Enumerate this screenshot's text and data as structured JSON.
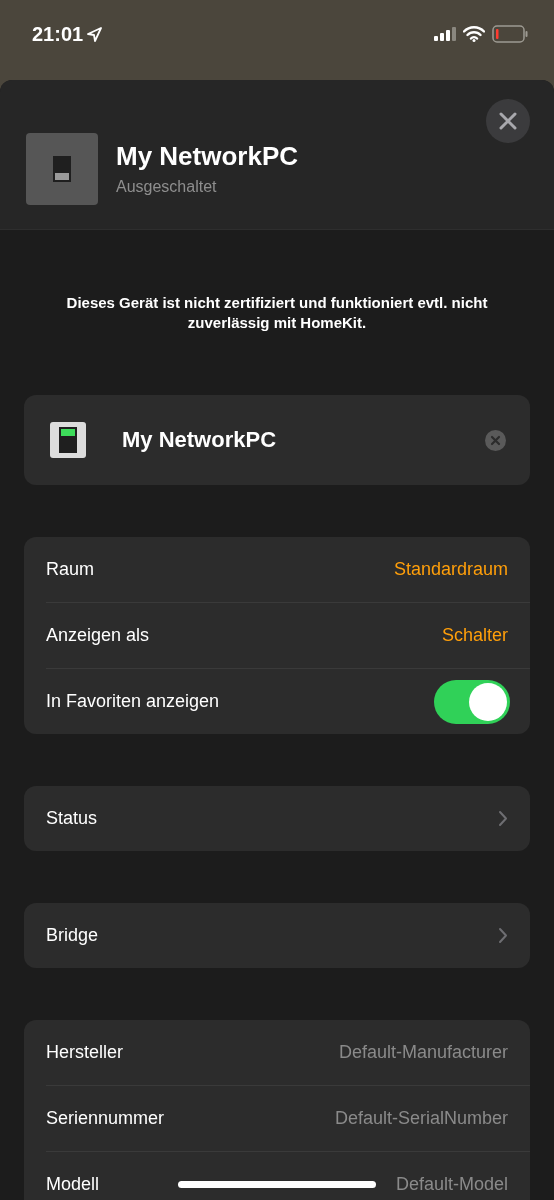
{
  "status_bar": {
    "time": "21:01"
  },
  "header": {
    "title": "My NetworkPC",
    "subtitle": "Ausgeschaltet",
    "on": false
  },
  "notice": "Dieses Gerät ist nicht zertifiziert und funktioniert evtl. nicht zuverlässig mit HomeKit.",
  "name_field": {
    "value": "My NetworkPC",
    "on": true
  },
  "groups": [
    [
      {
        "kind": "value",
        "label": "Raum",
        "value": "Standardraum"
      },
      {
        "kind": "value",
        "label": "Anzeigen als",
        "value": "Schalter"
      },
      {
        "kind": "toggle",
        "label": "In Favoriten anzeigen",
        "on": true
      }
    ],
    [
      {
        "kind": "link",
        "label": "Status"
      }
    ],
    [
      {
        "kind": "link",
        "label": "Bridge"
      }
    ],
    [
      {
        "kind": "info",
        "label": "Hersteller",
        "value": "Default-Manufacturer"
      },
      {
        "kind": "info",
        "label": "Seriennummer",
        "value": "Default-SerialNumber"
      },
      {
        "kind": "info",
        "label": "Modell",
        "value": "Default-Model"
      }
    ]
  ]
}
